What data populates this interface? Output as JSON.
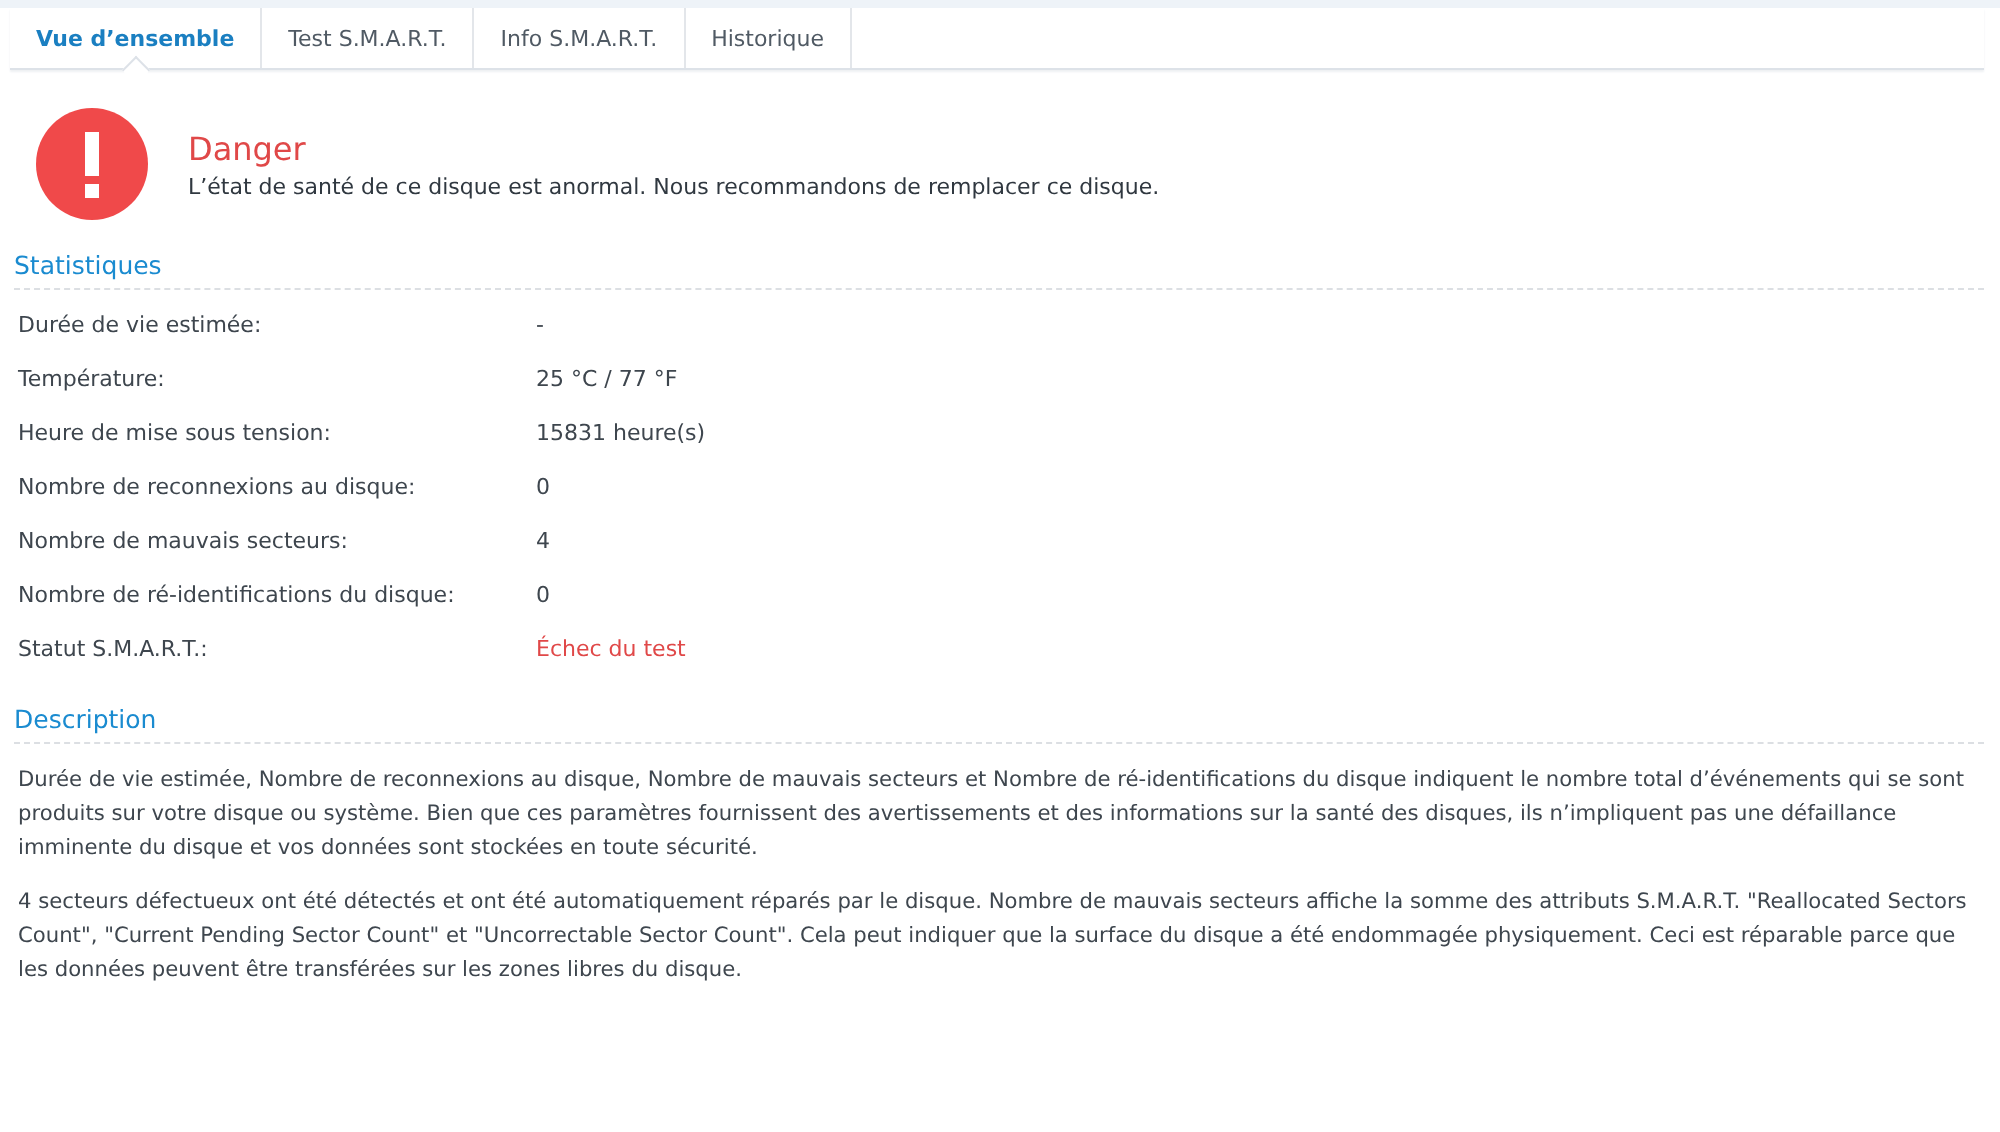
{
  "tabs": [
    {
      "label": "Vue d’ensemble",
      "selected": true
    },
    {
      "label": "Test S.M.A.R.T.",
      "selected": false
    },
    {
      "label": "Info S.M.A.R.T.",
      "selected": false
    },
    {
      "label": "Historique",
      "selected": false
    }
  ],
  "status": {
    "title": "Danger",
    "message": "L’état de santé de ce disque est anormal. Nous recommandons de remplacer ce disque."
  },
  "statistics": {
    "heading": "Statistiques",
    "rows": [
      {
        "label": "Durée de vie estimée:",
        "value": "-",
        "alert": false
      },
      {
        "label": "Température:",
        "value": "25 °C / 77 °F",
        "alert": false
      },
      {
        "label": "Heure de mise sous tension:",
        "value": "15831 heure(s)",
        "alert": false
      },
      {
        "label": "Nombre de reconnexions au disque:",
        "value": "0",
        "alert": false
      },
      {
        "label": "Nombre de mauvais secteurs:",
        "value": "4",
        "alert": false
      },
      {
        "label": "Nombre de ré-identifications du disque:",
        "value": "0",
        "alert": false
      },
      {
        "label": "Statut S.M.A.R.T.:",
        "value": "Échec du test",
        "alert": true
      }
    ]
  },
  "description": {
    "heading": "Description",
    "paragraphs": [
      "Durée de vie estimée, Nombre de reconnexions au disque, Nombre de mauvais secteurs et Nombre de ré-identifications du disque indiquent le nombre total d’événements qui se sont produits sur votre disque ou système. Bien que ces paramètres fournissent des avertissements et des informations sur la santé des disques, ils n’impliquent pas une défaillance imminente du disque et vos données sont stockées en toute sécurité.",
      "4 secteurs défectueux ont été détectés et ont été automatiquement réparés par le disque. Nombre de mauvais secteurs affiche la somme des attributs S.M.A.R.T. \"Reallocated Sectors Count\", \"Current Pending Sector Count\" et \"Uncorrectable Sector Count\". Cela peut indiquer que la surface du disque a été endommagée physiquement. Ceci est réparable parce que les données peuvent être transférées sur les zones libres du disque."
    ]
  }
}
